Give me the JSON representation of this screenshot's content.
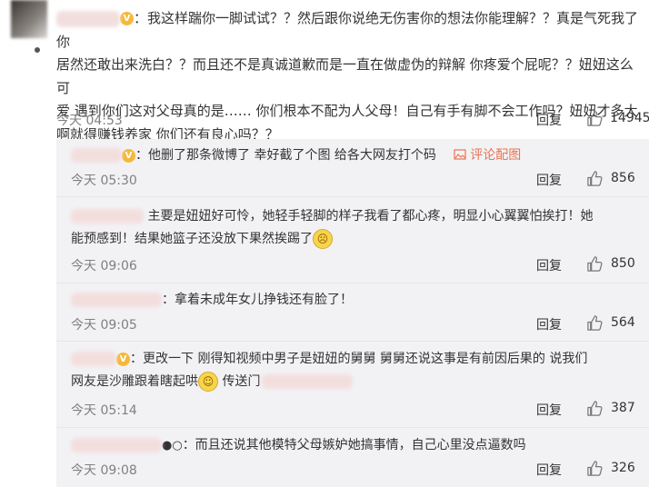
{
  "main_comment": {
    "text_line1": "：我这样踹你一脚试试？？然后跟你说绝无伤害你的想法你能理解？？真是气死我了你",
    "text_line2": "居然还敢出来洗白？？而且还不是真诚道歉而是一直在做虚伪的辩解 你疼爱个屁呢？？妞妞这么可",
    "text_line3": "爱 遇到你们这对父母真的是…… 你们根本不配为人父母！自己有手有脚不会工作吗？妞妞才多大",
    "text_line4": "啊就得赚钱养家 你们还有良心吗？？",
    "time": "今天 04:53",
    "reply_label": "回复",
    "likes": "14945"
  },
  "sub_comments": [
    {
      "text": "：他删了那条微博了 幸好截了个图 给各大网友打个码",
      "extra_link": "评论配图",
      "time": "今天 05:30",
      "reply_label": "回复",
      "likes": "856"
    },
    {
      "text_line1": "主要是妞妞好可怜，她轻手轻脚的样子我看了都心疼，明显小心翼翼怕挨打！她",
      "text_line2": "能预感到！结果她篮子还没放下果然挨踢了",
      "time": "今天 09:06",
      "reply_label": "回复",
      "likes": "850"
    },
    {
      "text": "：拿着未成年女儿挣钱还有脸了！",
      "time": "今天 09:05",
      "reply_label": "回复",
      "likes": "564"
    },
    {
      "text_line1": "：更改一下 刚得知视频中男子是妞妞的舅舅 舅舅还说这事是有前因后果的 说我们",
      "text_line2a": "网友是沙雕跟着瞎起哄",
      "text_line2b": " 传送门",
      "time": "今天 05:14",
      "reply_label": "回复",
      "likes": "387"
    },
    {
      "text": "：而且还说其他模特父母嫉妒她搞事情，自己心里没点逼数吗",
      "time": "今天 09:08",
      "reply_label": "回复",
      "likes": "326"
    }
  ],
  "icons": {
    "like": "thumbs-up-icon",
    "picture": "image-icon",
    "vip": "vip-badge-icon"
  },
  "colors": {
    "accent": "#eb7350",
    "meta": "#808080",
    "sub_bg": "#f2f2f5"
  }
}
